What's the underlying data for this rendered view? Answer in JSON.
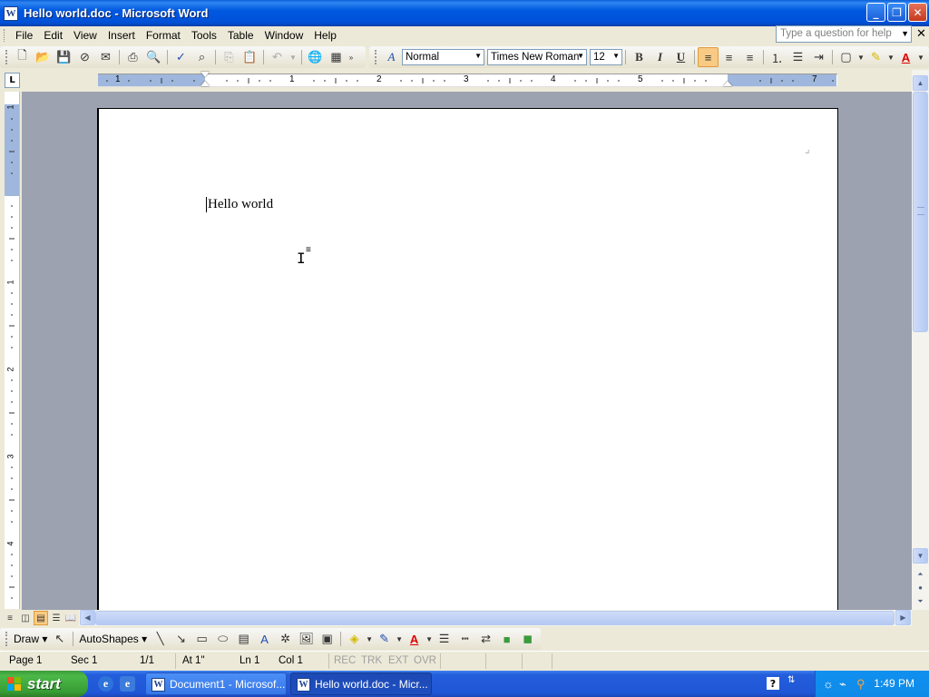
{
  "window": {
    "title": "Hello world.doc - Microsoft Word",
    "app_icon": "W"
  },
  "menubar": {
    "items": [
      "File",
      "Edit",
      "View",
      "Insert",
      "Format",
      "Tools",
      "Table",
      "Window",
      "Help"
    ],
    "help_placeholder": "Type a question for help"
  },
  "formatting": {
    "style": "Normal",
    "font": "Times New Roman",
    "size": "12",
    "bold": "B",
    "italic": "I",
    "underline": "U"
  },
  "ruler": {
    "h_marks": [
      "1",
      "1",
      "2",
      "3",
      "4",
      "5",
      "7"
    ],
    "v_marks": [
      "1",
      "1",
      "2",
      "3",
      "4"
    ]
  },
  "document": {
    "text": "Hello world"
  },
  "drawbar": {
    "draw_label": "Draw",
    "autoshapes_label": "AutoShapes"
  },
  "statusbar": {
    "page": "Page 1",
    "sec": "Sec 1",
    "pages": "1/1",
    "at": "At 1\"",
    "ln": "Ln 1",
    "col": "Col 1",
    "rec": "REC",
    "trk": "TRK",
    "ext": "EXT",
    "ovr": "OVR"
  },
  "taskbar": {
    "start_label": "start",
    "tasks": [
      "Document1 - Microsof...",
      "Hello world.doc - Micr..."
    ],
    "clock": "1:49 PM"
  },
  "colors": {
    "title_bar": "#0058e0",
    "doc_background": "#9ca2b0",
    "taskbar": "#245edb",
    "start_button": "#3a9c3a",
    "active_toggle": "#f9ca84"
  }
}
